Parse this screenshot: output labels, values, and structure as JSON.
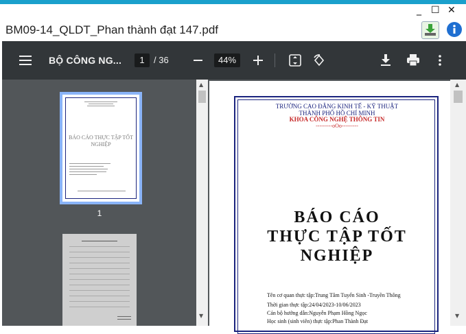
{
  "window": {
    "minimize_glyph": "_",
    "maximize_glyph": "☐",
    "close_glyph": "✕",
    "file_title": "BM09-14_QLDT_Phan thành đạt  147.pdf",
    "download_icon": "download-icon",
    "info_icon": "info-icon"
  },
  "toolbar": {
    "doc_title": "BỘ CÔNG NG...",
    "current_page": "1",
    "page_total": "/ 36",
    "zoom": "44%",
    "colors": {
      "background": "#323639",
      "input_bg": "#191b1c",
      "accent": "#8ab4f8"
    }
  },
  "sidebar": {
    "thumb1_label": "1",
    "thumb1_title": "BÁO CÁO THỰC TẬP TỐT NGHIỆP"
  },
  "page": {
    "school_line1": "TRƯỜNG CAO ĐẲNG KINH TẾ - KỸ THUẬT",
    "school_line2": "THÀNH PHỐ HỒ CHÍ MINH",
    "faculty": "KHOA CÔNG NGHỆ THÔNG TIN",
    "divider": "---------oOo---------",
    "title1": "BÁO CÁO",
    "title2": "THỰC TẬP TỐT",
    "title3": "NGHIỆP",
    "info1": "Tên cơ quan thực tập:Trung Tâm Tuyển Sinh -Truyền Thông",
    "info2": "Thời gian thực tập:24/04/2023-10/06/2023",
    "info3": "Cán bộ hướng dẫn:Nguyễn Phạm Hồng Ngọc",
    "info4": "Học sinh (sinh viên) thực tập:Phan Thành Đạt"
  }
}
